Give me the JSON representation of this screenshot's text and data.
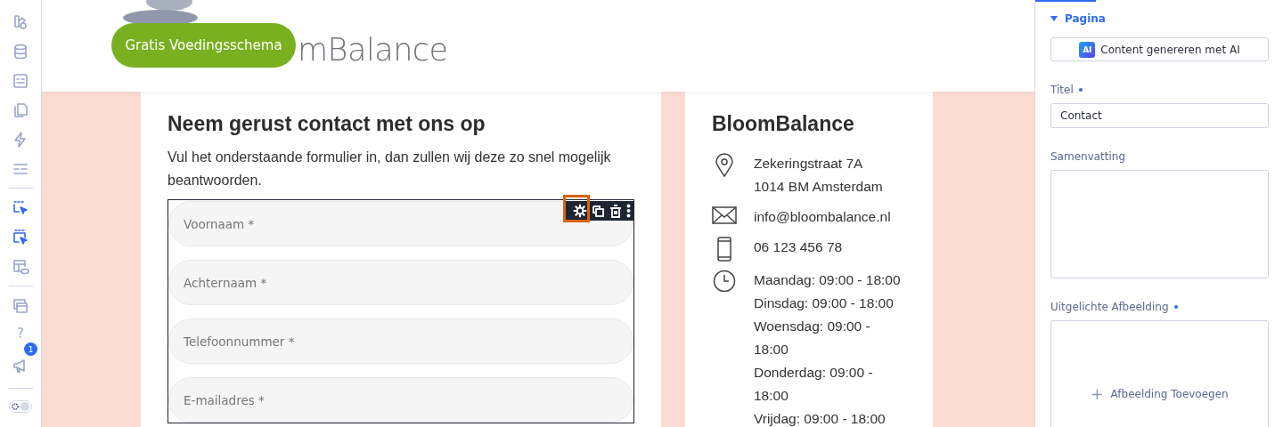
{
  "sidebar": {
    "help_glyph": "?",
    "notification_badge": "1",
    "theme_toggle": {
      "on": true
    }
  },
  "header": {
    "cta_button": "Gratis Voedingsschema",
    "logo_text": "mBalance"
  },
  "contact_form_card": {
    "title": "Neem gerust contact met ons op",
    "intro": "Vul het onderstaande formulier in, dan zullen wij deze zo snel mogelijk beantwoorden.",
    "fields": [
      {
        "placeholder": "Voornaam *"
      },
      {
        "placeholder": "Achternaam *"
      },
      {
        "placeholder": "Telefoonnummer *"
      },
      {
        "placeholder": "E-mailadres *"
      }
    ]
  },
  "info_card": {
    "title": "BloomBalance",
    "rows": [
      {
        "kind": "address",
        "lines": [
          "Zekeringstraat 7A",
          "1014 BM Amsterdam"
        ]
      },
      {
        "kind": "email",
        "lines": [
          "info@bloombalance.nl"
        ]
      },
      {
        "kind": "phone",
        "lines": [
          "06 123 456 78"
        ]
      },
      {
        "kind": "hours",
        "lines": [
          "Maandag: 09:00 - 18:00",
          "Dinsdag: 09:00 - 18:00",
          "Woensdag: 09:00 -",
          "18:00",
          "Donderdag: 09:00 -",
          "18:00",
          "Vrijdag: 09:00 - 18:00"
        ]
      }
    ]
  },
  "panel": {
    "section": {
      "title": "Pagina",
      "expanded": true
    },
    "ai_button": {
      "badge": "AI",
      "label": "Content genereren met AI"
    },
    "title_label": "Titel",
    "title_value": "Contact",
    "summary_label": "Samenvatting",
    "image_label": "Uitgelichte Afbeelding",
    "add_image": {
      "glyph": "+",
      "label": "Afbeelding Toevoegen"
    }
  }
}
